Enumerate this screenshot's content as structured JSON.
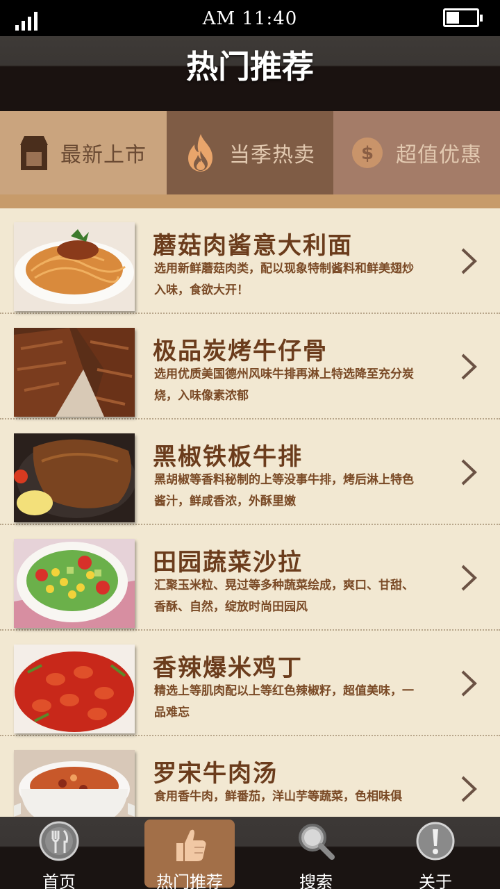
{
  "status_bar": {
    "time": "AM 11:40"
  },
  "header": {
    "title": "热门推荐"
  },
  "tabs": [
    {
      "label": "最新上市",
      "icon": "store-icon"
    },
    {
      "label": "当季热卖",
      "icon": "flame-icon"
    },
    {
      "label": "超值优惠",
      "icon": "dollar-coin-icon"
    }
  ],
  "items": [
    {
      "name": "蘑菇肉酱意大利面",
      "desc": "选用新鲜蘑菇肉类，配以现象特制酱料和鲜美翅炒入味，食欲大开！"
    },
    {
      "name": "极品炭烤牛仔骨",
      "desc": "选用优质美国德州风味牛排再淋上特选降至充分炭烧，入味像素浓郁"
    },
    {
      "name": "黑椒铁板牛排",
      "desc": "黑胡椒等香料秘制的上等没事牛排，烤后淋上特色酱汁，鲜咸香浓，外酥里嫩"
    },
    {
      "name": "田园蔬菜沙拉",
      "desc": "汇聚玉米粒、晃过等多种蔬菜绘成，爽口、甘甜、香酥、自然，绽放时尚田园风"
    },
    {
      "name": "香辣爆米鸡丁",
      "desc": "精选上等肌肉配以上等红色辣椒籽，超值美味，一品难忘"
    },
    {
      "name": "罗宋牛肉汤",
      "desc": "食用香牛肉，鲜番茄，洋山芋等蔬菜，色相味俱"
    }
  ],
  "tabbar": [
    {
      "label": "首页",
      "icon": "fork-knife-icon"
    },
    {
      "label": "热门推荐",
      "icon": "thumbs-up-icon"
    },
    {
      "label": "搜索",
      "icon": "magnifier-icon"
    },
    {
      "label": "关于",
      "icon": "exclamation-icon"
    }
  ],
  "colors": {
    "background": "#f2e8d2",
    "title_text": "#6b3c1c",
    "active_tab": "#7f5c45",
    "active_nav": "#a26f48"
  }
}
